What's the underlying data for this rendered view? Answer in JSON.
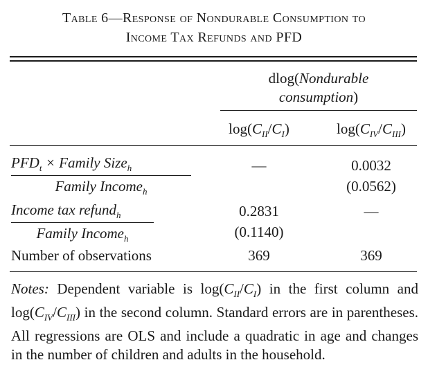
{
  "table": {
    "title_line1": "Table 6—Response of Nondurable Consumption to",
    "title_line2": "Income Tax Refunds and PFD",
    "header": {
      "group_prefix": "dlog(",
      "group_italic": "Nondurable",
      "group_line2": "consumption",
      "group_suffix": ")",
      "col1": "log(C_II/C_I)",
      "col2": "log(C_IV/C_III)"
    },
    "rows": [
      {
        "label_num": "PFD_t × Family Size_h",
        "label_den": "Family Income_h",
        "col1_est": "—",
        "col1_se": "",
        "col2_est": "0.0032",
        "col2_se": "(0.0562)"
      },
      {
        "label_num": "Income tax refund_h",
        "label_den": "Family Income_h",
        "col1_est": "0.2831",
        "col1_se": "(0.1140)",
        "col2_est": "—",
        "col2_se": ""
      }
    ],
    "obs_row": {
      "label": "Number of observations",
      "col1": "369",
      "col2": "369"
    },
    "notes": {
      "label": "Notes:",
      "text": "Dependent variable is log(C_II/C_I) in the first column and log(C_IV/C_III) in the second column. Standard errors are in parentheses. All regressions are OLS and include a quadratic in age and changes in the number of children and adults in the household."
    }
  }
}
